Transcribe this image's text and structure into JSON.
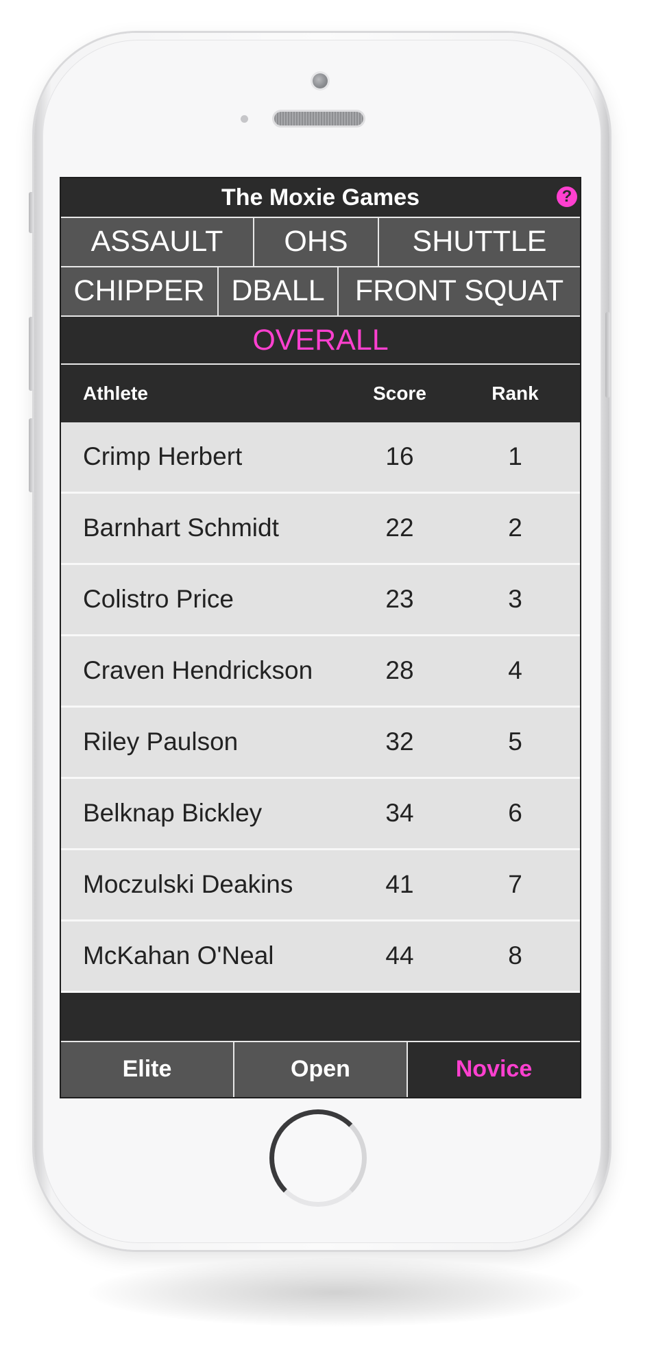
{
  "app": {
    "title": "The Moxie Games",
    "help_icon": "?"
  },
  "events_row1": [
    "ASSAULT",
    "OHS",
    "SHUTTLE"
  ],
  "events_row2": [
    "CHIPPER",
    "DBALL",
    "FRONT SQUAT"
  ],
  "overall_label": "OVERALL",
  "table": {
    "headers": {
      "athlete": "Athlete",
      "score": "Score",
      "rank": "Rank"
    },
    "rows": [
      {
        "athlete": "Crimp Herbert",
        "score": "16",
        "rank": "1"
      },
      {
        "athlete": "Barnhart Schmidt",
        "score": "22",
        "rank": "2"
      },
      {
        "athlete": "Colistro Price",
        "score": "23",
        "rank": "3"
      },
      {
        "athlete": "Craven Hendrickson",
        "score": "28",
        "rank": "4"
      },
      {
        "athlete": "Riley Paulson",
        "score": "32",
        "rank": "5"
      },
      {
        "athlete": "Belknap Bickley",
        "score": "34",
        "rank": "6"
      },
      {
        "athlete": "Moczulski Deakins",
        "score": "41",
        "rank": "7"
      },
      {
        "athlete": "McKahan O'Neal",
        "score": "44",
        "rank": "8"
      }
    ]
  },
  "divisions": {
    "items": [
      "Elite",
      "Open",
      "Novice"
    ],
    "active": "Novice"
  },
  "colors": {
    "accent": "#ff40d0",
    "header_bg": "#2b2b2b",
    "tab_bg": "#555555",
    "row_bg": "#e2e2e2"
  }
}
